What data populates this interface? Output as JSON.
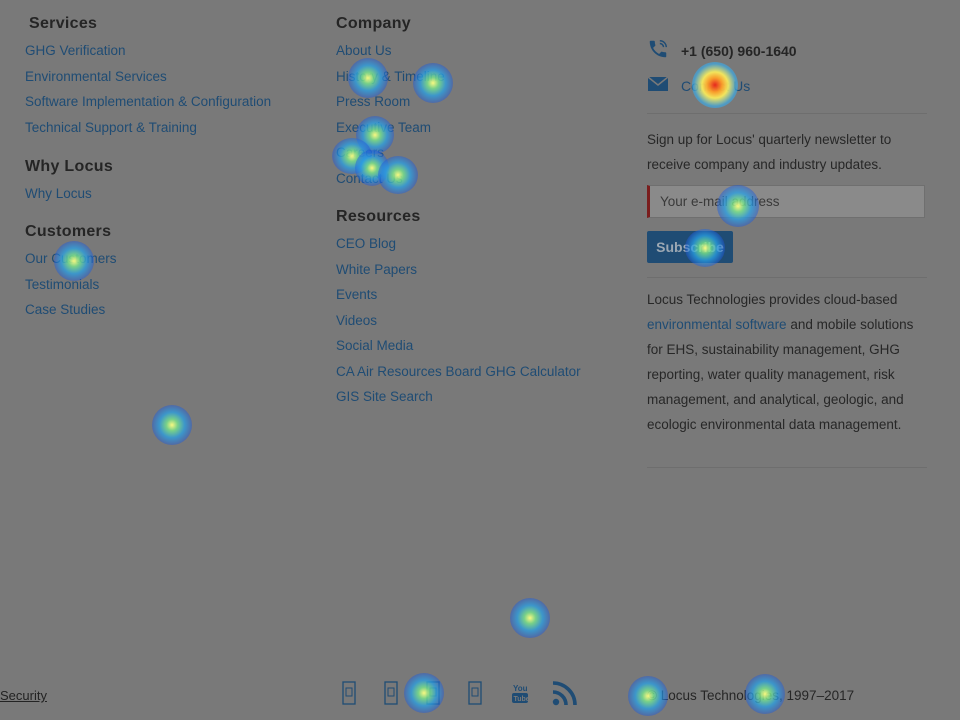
{
  "services": {
    "heading": "Services",
    "links": [
      "GHG Verification",
      "Environmental Services",
      "Software Implementation & Configuration",
      "Technical Support & Training"
    ]
  },
  "why_locus": {
    "heading": "Why Locus",
    "links": [
      "Why Locus"
    ]
  },
  "customers": {
    "heading": "Customers",
    "links": [
      "Our Customers",
      "Testimonials",
      "Case Studies"
    ]
  },
  "company": {
    "heading": "Company",
    "links": [
      "About Us",
      "History & Timeline",
      "Press Room",
      "Executive Team",
      "Careers",
      "Contact Us"
    ]
  },
  "resources": {
    "heading": "Resources",
    "links": [
      "CEO Blog",
      "White Papers",
      "Events",
      "Videos",
      "Social Media",
      "CA Air Resources Board GHG Calculator",
      "GIS Site Search"
    ]
  },
  "contact": {
    "phone": "+1 (650) 960-1640",
    "phone_icon": "phone-icon",
    "mail_label": "Contact Us",
    "mail_icon": "envelope-icon"
  },
  "newsletter": {
    "text": "Sign up for Locus' quarterly newsletter to receive company and industry updates.",
    "email_placeholder": "Your e-mail address",
    "subscribe_label": "Subscribe"
  },
  "about": {
    "text_before": "Locus Technologies provides cloud-based ",
    "link_text": "environmental software",
    "text_after": " and mobile solutions for EHS, sustainability management, GHG reporting, water quality management, risk management, and analytical, geologic, and ecologic environmental data management."
  },
  "footer": {
    "security_label": "Security",
    "social_icons": [
      "facebook-icon",
      "twitter-icon",
      "linkedin-icon",
      "googleplus-icon",
      "youtube-icon",
      "rss-icon"
    ],
    "copyright": "© Locus Technologies, 1997–2017"
  },
  "colors": {
    "link": "#1f4c74",
    "overlay": "#797979"
  }
}
